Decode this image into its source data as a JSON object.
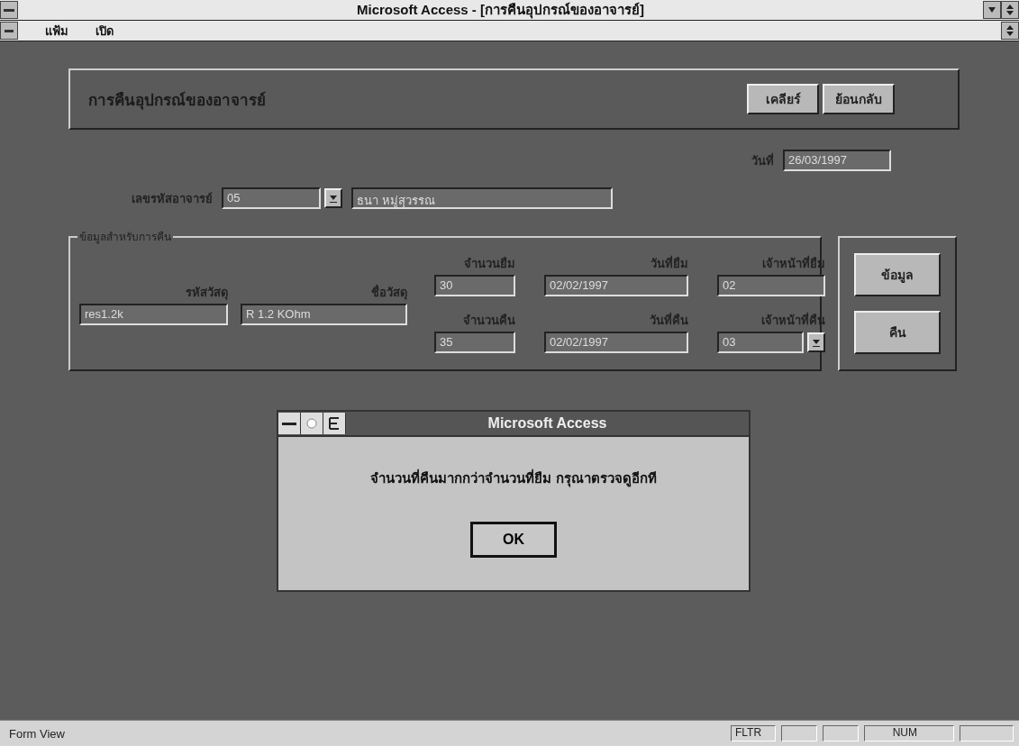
{
  "window": {
    "title": "Microsoft Access - [การคืนอุปกรณ์ของอาจารย์]"
  },
  "menu": [
    {
      "label": "แฟ้ม"
    },
    {
      "label": "เปิด"
    }
  ],
  "form": {
    "title": "การคืนอุปกรณ์ของอาจารย์",
    "buttons": [
      {
        "label": "เคลียร์"
      },
      {
        "label": "ย้อนกลับ"
      }
    ],
    "date": {
      "label": "วันที่",
      "value": "26/03/1997"
    },
    "teacher": {
      "label": "เลขรหัสอาจารย์",
      "code": "05",
      "name": "ธนา หมู่สุวรรณ"
    },
    "group": {
      "title": "ข้อมูลสำหรับการคืน",
      "item_fields": [
        {
          "label": "รหัสวัสดุ",
          "value": "res1.2k",
          "kind": "text"
        },
        {
          "label": "ชื่อวัสดุ",
          "value": "R 1.2 KOhm",
          "kind": "text"
        }
      ],
      "loan_fields": [
        {
          "label": "จำนวนยืม",
          "value": "30",
          "kind": "text"
        },
        {
          "label": "วันที่ยืม",
          "value": "02/02/1997",
          "kind": "text"
        },
        {
          "label": "เจ้าหน้าที่ยืม",
          "value": "02",
          "kind": "text"
        },
        {
          "label": "จำนวนคืน",
          "value": "35",
          "kind": "text"
        },
        {
          "label": "วันที่คืน",
          "value": "02/02/1997",
          "kind": "text"
        },
        {
          "label": "เจ้าหน้าที่คืน",
          "value": "03",
          "kind": "combo"
        }
      ]
    },
    "side_buttons": [
      {
        "label": "ข้อมูล"
      },
      {
        "label": "คืน"
      }
    ]
  },
  "dialog": {
    "title": "Microsoft Access",
    "message": "จำนวนที่คืนมากกว่าจำนวนที่ยืม กรุณาตรวจดูอีกที",
    "button": "OK"
  },
  "status_bar": {
    "mode": "Form View",
    "indicators": [
      {
        "label": "FLTR"
      },
      {
        "label": "NUM"
      }
    ]
  }
}
